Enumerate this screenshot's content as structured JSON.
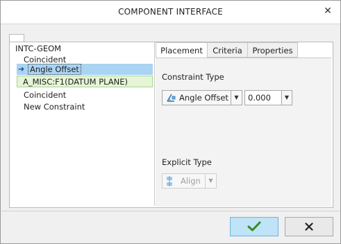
{
  "window": {
    "title": "COMPONENT INTERFACE"
  },
  "tree": {
    "root": "INTC-GEOM",
    "items": [
      {
        "label": "Coincident"
      },
      {
        "label": "Angle Offset",
        "selected": true
      },
      {
        "label": "A_MISC:F1(DATUM PLANE)"
      },
      {
        "label": "Coincident"
      },
      {
        "label": "New Constraint"
      }
    ]
  },
  "tabs": [
    {
      "label": "Placement",
      "active": true
    },
    {
      "label": "Criteria"
    },
    {
      "label": "Properties"
    }
  ],
  "placement": {
    "constraint_type_label": "Constraint Type",
    "constraint_type_value": "Angle Offset",
    "offset_value": "0.000",
    "explicit_type_label": "Explicit Type",
    "explicit_type_value": "Align"
  },
  "icons": {
    "selected_marker": "arrow-right-icon",
    "constraint": "angle-offset-icon",
    "explicit": "align-icon",
    "ok": "checkmark-icon",
    "cancel": "x-icon",
    "close": "close-icon"
  },
  "colors": {
    "selection": "#a9d4f2",
    "reference_bg": "#e6f4d7",
    "ok_button": "#bfe3f7",
    "ok_check": "#3a8a1f"
  }
}
